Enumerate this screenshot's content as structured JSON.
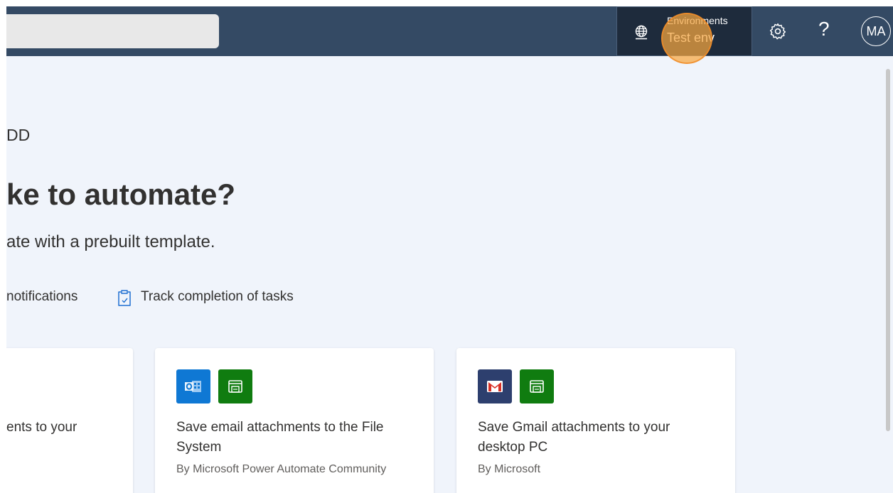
{
  "topbar": {
    "environment": {
      "label": "Environments",
      "name": "Test env"
    },
    "help_label": "?",
    "avatar_initials": "MA"
  },
  "main": {
    "greeting": "DD",
    "heading": "ke to automate?",
    "subtitle": "ate with a prebuilt template.",
    "chips": [
      {
        "label": "notifications"
      },
      {
        "label": "Track completion of tasks",
        "icon": "clipboard-icon"
      }
    ],
    "cards": [
      {
        "title": "ents to your"
      },
      {
        "title": "Save email attachments to the File System",
        "author": "By Microsoft Power Automate Community",
        "icons": [
          "outlook-icon",
          "file-system-icon"
        ]
      },
      {
        "title": "Save Gmail attachments to your desktop PC",
        "author": "By Microsoft",
        "icons": [
          "gmail-icon",
          "file-system-icon"
        ]
      }
    ]
  },
  "colors": {
    "topbar": "#344a64",
    "env_box": "#1e2b3c",
    "page_bg": "#f0f4fb",
    "outlook_blue": "#0f78d4",
    "file_green": "#107c10",
    "gmail_navy": "#2d3f6e",
    "highlight": "#f6a640",
    "chip_icon": "#1f6fd1"
  }
}
